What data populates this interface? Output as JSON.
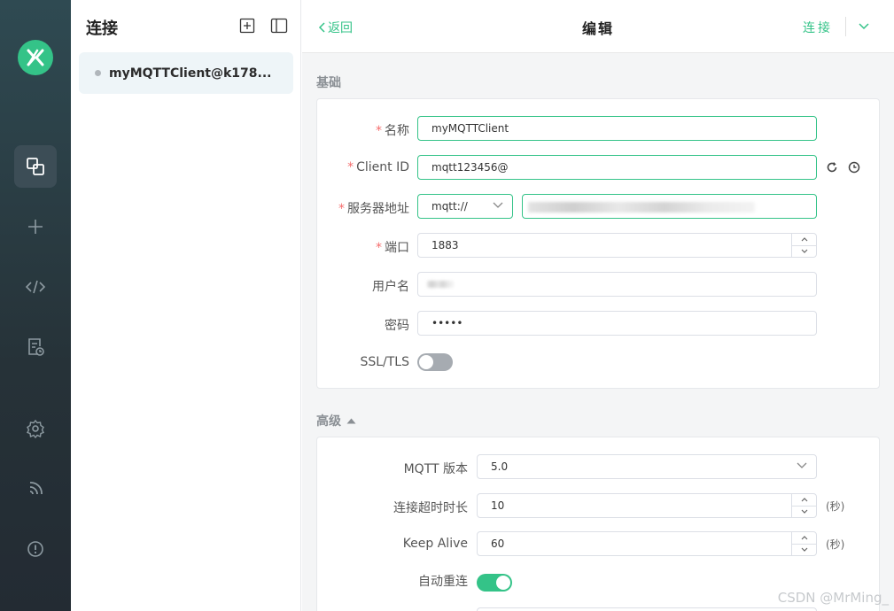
{
  "colors": {
    "accent": "#34c388",
    "rail": "#263238",
    "required": "#f56c6c"
  },
  "sidebar": {
    "logo": "mqttx-logo-icon",
    "nav_icons": [
      "connections-icon",
      "plus-icon",
      "code-icon",
      "log-icon",
      "settings-icon",
      "feed-icon",
      "info-icon"
    ]
  },
  "connections": {
    "title": "连接",
    "items": [
      {
        "name": "myMQTTClient@k178..."
      }
    ]
  },
  "header": {
    "back_label": "返回",
    "title": "编辑",
    "connect_label": "连接"
  },
  "basic": {
    "section_label": "基础",
    "name_label": "名称",
    "name_value": "myMQTTClient",
    "client_id_label": "Client ID",
    "client_id_value": "mqtt123456@",
    "host_label": "服务器地址",
    "protocol_value": "mqtt://",
    "port_label": "端口",
    "port_value": "1883",
    "username_label": "用户名",
    "password_label": "密码",
    "password_value": "•••••",
    "ssl_label": "SSL/TLS",
    "ssl_enabled": false
  },
  "advanced": {
    "section_label": "高级",
    "mqtt_version_label": "MQTT 版本",
    "mqtt_version_value": "5.0",
    "timeout_label": "连接超时时长",
    "timeout_value": "10",
    "timeout_unit": "(秒)",
    "keepalive_label": "Keep Alive",
    "keepalive_value": "60",
    "keepalive_unit": "(秒)",
    "reconnect_label": "自动重连",
    "reconnect_enabled": true
  },
  "watermark": "CSDN @MrMing_"
}
